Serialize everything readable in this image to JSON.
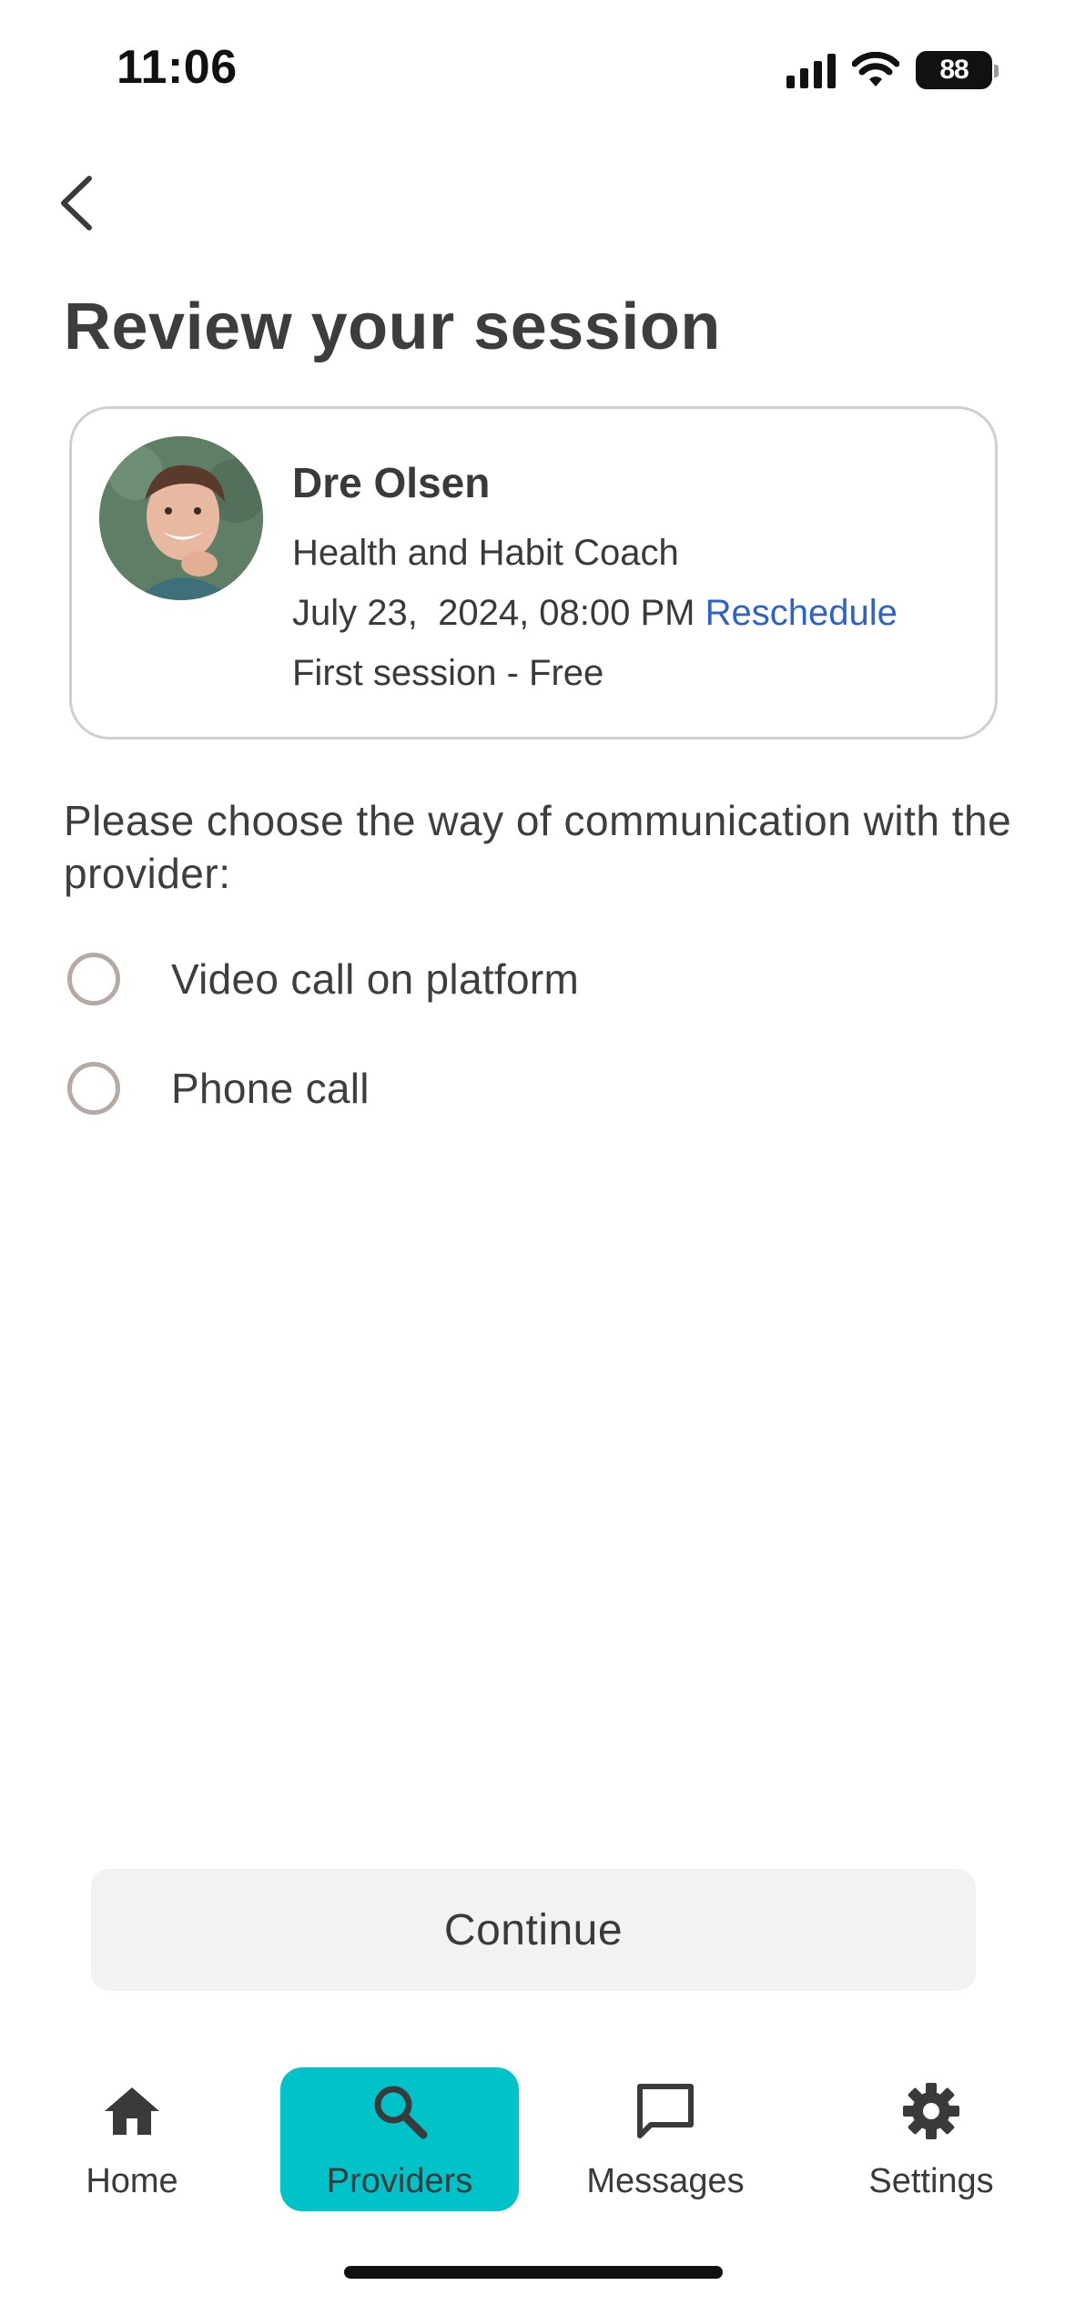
{
  "status_bar": {
    "time": "11:06",
    "battery": "88"
  },
  "header": {
    "title": "Review your session"
  },
  "provider": {
    "name": "Dre Olsen",
    "role": "Health and Habit Coach",
    "datetime": "July 23,  2024, 08:00 PM",
    "reschedule_label": "Reschedule",
    "price": "First session - Free"
  },
  "communication": {
    "prompt": "Please choose the way of communication with the provider:",
    "options": [
      {
        "label": "Video call on platform",
        "selected": false
      },
      {
        "label": "Phone call",
        "selected": false
      }
    ]
  },
  "continue_label": "Continue",
  "tab_bar": {
    "tabs": [
      {
        "label": "Home",
        "icon": "home-icon",
        "active": false
      },
      {
        "label": "Providers",
        "icon": "search-icon",
        "active": true
      },
      {
        "label": "Messages",
        "icon": "message-icon",
        "active": false
      },
      {
        "label": "Settings",
        "icon": "gear-icon",
        "active": false
      }
    ]
  },
  "colors": {
    "accent": "#00c3c9",
    "link": "#2d63c8",
    "radio_border": "#b6aaa4",
    "button_bg": "#f2f2f2"
  }
}
